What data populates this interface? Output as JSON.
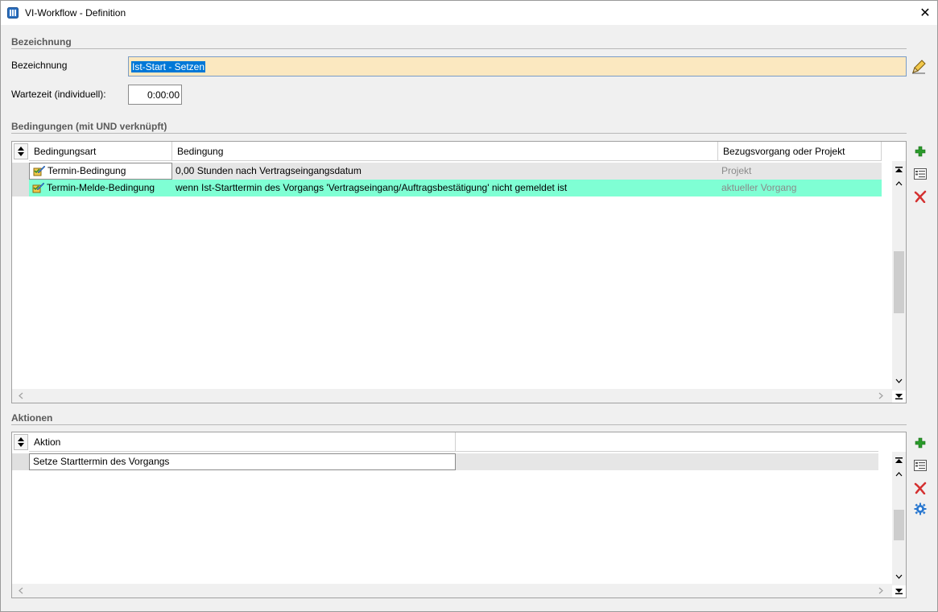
{
  "window": {
    "title": "VI-Workflow - Definition",
    "close_glyph": "✕"
  },
  "section_bezeichnung": {
    "title": "Bezeichnung",
    "name_label": "Bezeichnung",
    "name_value": "Ist-Start - Setzen",
    "wait_label": "Wartezeit (individuell):",
    "wait_value": "0:00:00"
  },
  "section_conditions": {
    "title": "Bedingungen (mit UND verknüpft)",
    "columns": [
      "Bedingungsart",
      "Bedingung",
      "Bezugsvorgang oder Projekt"
    ],
    "rows": [
      {
        "type": "Termin-Bedingung",
        "condition": "0,00 Stunden nach Vertragseingangsdatum",
        "ref": "Projekt"
      },
      {
        "type": "Termin-Melde-Bedingung",
        "condition": "wenn Ist-Starttermin des Vorgangs 'Vertragseingang/Auftragsbestätigung' nicht gemeldet ist",
        "ref": "aktueller Vorgang"
      }
    ]
  },
  "section_actions": {
    "title": "Aktionen",
    "columns": [
      "Aktion"
    ],
    "rows": [
      {
        "action": "Setze Starttermin des Vorgangs"
      }
    ]
  },
  "colors": {
    "selected_row": "#7fffd4",
    "input_highlight": "#fbe8c0",
    "add_icon": "#2a9a2a",
    "delete_icon": "#d43030",
    "settings_icon": "#2a78d0"
  },
  "icons": [
    "app-icon",
    "close-icon",
    "edit-pencil-icon",
    "sort-icon",
    "condition-type-icon",
    "add-icon",
    "edit-list-icon",
    "delete-icon",
    "settings-icon",
    "scroll-top-icon",
    "scroll-up-icon",
    "scroll-down-icon",
    "scroll-bottom-icon",
    "scroll-left-icon",
    "scroll-right-icon"
  ]
}
